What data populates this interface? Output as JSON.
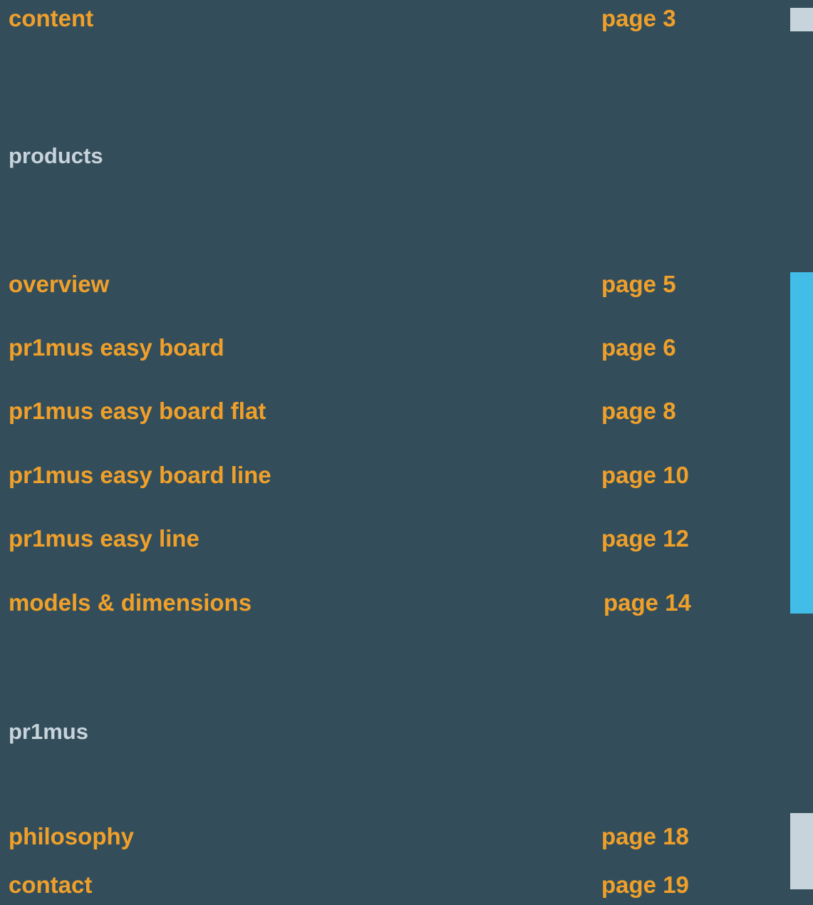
{
  "theme": {
    "background": "#334e5a",
    "link_color": "#f0a02a",
    "section_color": "#c8d4dc",
    "marker_gray": "#c8d4dc",
    "marker_blue": "#42bde8"
  },
  "header": {
    "title": "content",
    "page": "page 3"
  },
  "sections": [
    {
      "heading": "products",
      "items": [
        {
          "title": "overview",
          "page": "page 5"
        },
        {
          "title": "pr1mus easy board",
          "page": "page 6"
        },
        {
          "title": "pr1mus easy board flat",
          "page": "page 8"
        },
        {
          "title": "pr1mus easy board line",
          "page": "page 10"
        },
        {
          "title": "pr1mus easy line",
          "page": "page 12"
        },
        {
          "title": "models & dimensions",
          "page": "page 14"
        }
      ]
    },
    {
      "heading": "pr1mus",
      "items": [
        {
          "title": "philosophy",
          "page": "page 18"
        },
        {
          "title": "contact",
          "page": "page 19"
        }
      ]
    }
  ]
}
